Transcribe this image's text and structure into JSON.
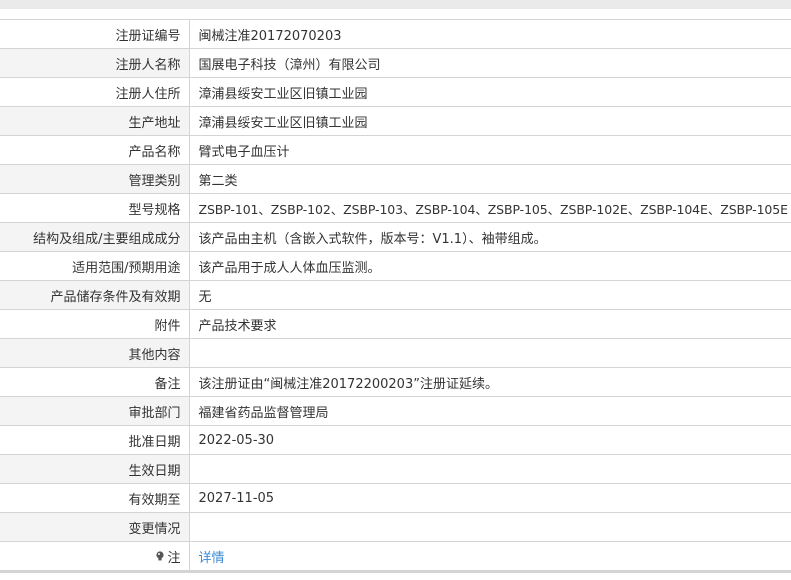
{
  "rows": [
    {
      "label": "注册证编号",
      "value": "闽械注准20172070203"
    },
    {
      "label": "注册人名称",
      "value": "国展电子科技（漳州）有限公司"
    },
    {
      "label": "注册人住所",
      "value": "漳浦县绥安工业区旧镇工业园"
    },
    {
      "label": "生产地址",
      "value": "漳浦县绥安工业区旧镇工业园"
    },
    {
      "label": "产品名称",
      "value": "臂式电子血压计"
    },
    {
      "label": "管理类别",
      "value": "第二类"
    },
    {
      "label": "型号规格",
      "value": "ZSBP-101、ZSBP-102、ZSBP-103、ZSBP-104、ZSBP-105、ZSBP-102E、ZSBP-104E、ZSBP-105E"
    },
    {
      "label": "结构及组成/主要组成成分",
      "value": "该产品由主机（含嵌入式软件，版本号：V1.1）、袖带组成。"
    },
    {
      "label": "适用范围/预期用途",
      "value": "该产品用于成人人体血压监测。"
    },
    {
      "label": "产品储存条件及有效期",
      "value": "无"
    },
    {
      "label": "附件",
      "value": "产品技术要求"
    },
    {
      "label": "其他内容",
      "value": ""
    },
    {
      "label": "备注",
      "value": "该注册证由“闽械注准20172200203”注册证延续。"
    },
    {
      "label": "审批部门",
      "value": "福建省药品监督管理局"
    },
    {
      "label": "批准日期",
      "value": "2022-05-30"
    },
    {
      "label": "生效日期",
      "value": ""
    },
    {
      "label": "有效期至",
      "value": "2027-11-05"
    },
    {
      "label": "变更情况",
      "value": ""
    }
  ],
  "note": {
    "label": "注",
    "link_text": "详情",
    "icon": "lightbulb-icon"
  },
  "colors": {
    "link": "#3b8bd6",
    "label_bg": "#f4f4f4",
    "border": "#d4d4d4"
  }
}
